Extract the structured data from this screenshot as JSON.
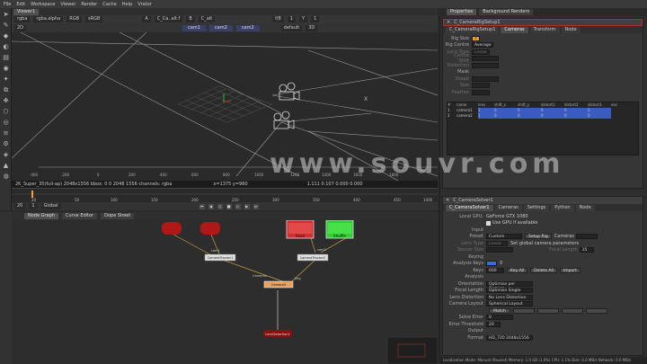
{
  "menu": [
    "File",
    "Edit",
    "Workspace",
    "Viewer",
    "Render",
    "Cache",
    "Help",
    "Vrator"
  ],
  "viewer": {
    "tab": "Viewer1",
    "channel": "rgba",
    "alpha_channel": "rgba.alpha",
    "colorspace_mode": "RGB",
    "lut": "sRGB",
    "input_a": "A",
    "input_a_name": "C_Ca..alt.f",
    "input_b": "B",
    "input_b_name": "C_alt",
    "gain_label": "f/8",
    "gain_value": "1",
    "gamma_label": "Y",
    "gamma_value": "1",
    "zoom": "2D",
    "view_mode": "3D",
    "cam_pill_1": "cam1",
    "cam_pill_2": "cam2",
    "cam_pill_3": "cam2",
    "default_pill": "default",
    "info_left": "2K_Super_35(full-ap) 2048x1556  bbox: 0 0 2048 1556 channels: rgba",
    "info_right": "x=1375 y=960",
    "info_end": "1.111 0.107 0.000 0.000",
    "ruler": [
      "-400",
      "-200",
      "0",
      "200",
      "400",
      "600",
      "800",
      "1000",
      "1200",
      "1400",
      "1600",
      "1800"
    ],
    "frame_current": "20",
    "frame_step": "1",
    "scope": "Global"
  },
  "timeline": {
    "labels": [
      "20",
      "50",
      "100",
      "150",
      "200",
      "250",
      "300",
      "350",
      "400",
      "450"
    ],
    "end": "1000"
  },
  "nodegraph": {
    "tabs": [
      "Node Graph",
      "Curve Editor",
      "Dope Sheet"
    ],
    "nodes": {
      "camera_a": "Camera1",
      "camera_b": "Camera2",
      "read": "Read",
      "shuffle": "Shuffle",
      "camtrack_a": "CameraTracker1",
      "camtrack_b": "CameraTracker2",
      "camera_out": "Camera3",
      "lens_distort": "LensDistortion1",
      "cam_label_1": "cam1",
      "cam_label_2": "cam2",
      "cameras_label": "Cameras",
      "img_label": "img"
    },
    "colors": {
      "red": "#d03030",
      "green": "#30d030",
      "orange": "#e8a060",
      "dark_red": "#8a1010"
    }
  },
  "properties": {
    "tabs": [
      "Properties",
      "Background Renders"
    ],
    "panel1": {
      "title": "C_CameraRigSetup1",
      "tabs": [
        "C_CameraRigSetup1",
        "Cameras",
        "Transform",
        "Node"
      ],
      "rows": [
        {
          "label": "Rig Size",
          "value": "7"
        },
        {
          "label": "Rig Centre",
          "value": "Average"
        },
        {
          "label": "Lens Type",
          "value": "Linear"
        },
        {
          "label": "Centre Shift",
          "value": ""
        },
        {
          "label": "Distortion",
          "value": ""
        }
      ],
      "mask_header": "Mask",
      "mask_rows": [
        "Shape",
        "Size",
        "Feather"
      ],
      "table_headers": [
        "#",
        "name",
        "lens",
        "shift_x",
        "shift_y",
        "distort1",
        "distort2",
        "distort3",
        "enc"
      ],
      "table_rows": [
        {
          "n": "1",
          "name": "camera1",
          "lens": "1",
          "sx": "0",
          "sy": "0",
          "d1": "0",
          "d2": "0",
          "d3": "0"
        },
        {
          "n": "2",
          "name": "camera2",
          "lens": "1",
          "sx": "0",
          "sy": "0",
          "d1": "0",
          "d2": "0",
          "d3": "0"
        }
      ]
    },
    "panel2": {
      "title": "C_CameraSolver1",
      "tabs": [
        "C_CameraSolver1",
        "Cameras",
        "Settings",
        "Python",
        "Node"
      ],
      "gpu_label": "Local GPU:",
      "gpu_value": "GeForce GTX 1080",
      "use_gpu": "Use GPU if available",
      "input_header": "Input",
      "preset_label": "Preset",
      "preset_value": "Custom",
      "setup_rig": "Setup Rig",
      "cameras_label": "Cameras",
      "lens_type_label": "Lens Type",
      "lens_type_value": "Linear",
      "global_cam_params": "Set global camera parameters",
      "sensor_label": "Sensor Size",
      "focal_label": "Focal Length",
      "focal_value": "35",
      "keying_header": "Keying",
      "analysis_label": "Analysis Keys",
      "analysis_value": "0",
      "keys_label": "Keys",
      "keys_value": "000",
      "key_all": "Key All",
      "delete_all": "Delete All",
      "import": "Import",
      "analysis_header": "Analysis",
      "orientation_label": "Orientation",
      "orientation_value": "Optimise per Camera",
      "focal_length_label": "Focal Length",
      "focal_length_value": "Optimise Single",
      "lens_distortion_label": "Lens Distortion",
      "lens_distortion_value": "No Lens Distortion",
      "camera_layout_label": "Camera Layout",
      "camera_layout_value": "Spherical Layout",
      "match": "Match",
      "solve_error_label": "Solve Error",
      "solve_error_value": "0",
      "error_threshold_label": "Error Threshold",
      "error_threshold_value": "20",
      "output_header": "Output",
      "format_label": "Format",
      "format_value": "HD_720 2048x1556"
    },
    "status": "Localization Mode: Manual (Paused)  Memory: 1.0 GB (1.6%)  CPU: 1.1%  Disk: 0.0 MB/s  Network: 0.0 MB/s"
  },
  "watermark": "www.souvr.com"
}
